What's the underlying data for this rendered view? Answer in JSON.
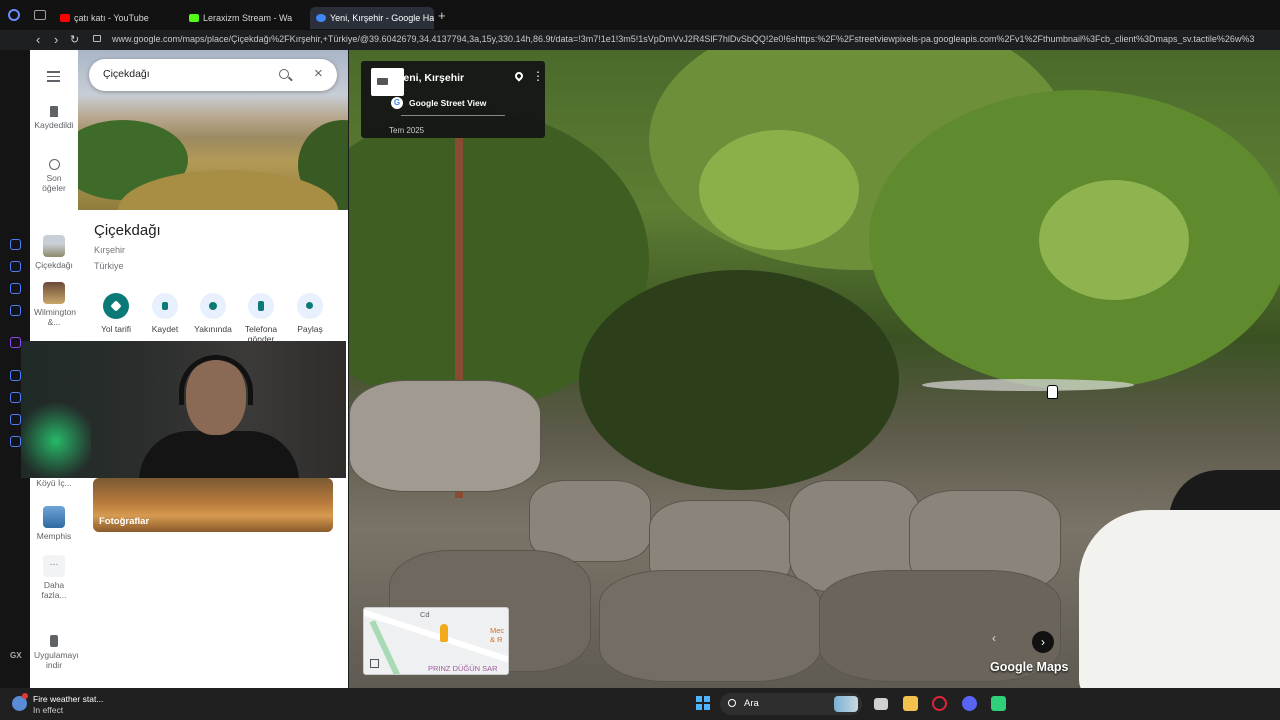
{
  "browser": {
    "tabs": [
      {
        "title": "çatı katı - YouTube",
        "favicon_color": "#ff0000",
        "active": false
      },
      {
        "title": "Leraxizm Stream - Wa",
        "favicon_color": "#53fc18",
        "active": false
      },
      {
        "title": "Yeni, Kırşehir - Google Ha",
        "favicon_color": "#4285f4",
        "active": true
      }
    ],
    "new_tab": "+",
    "back": "‹",
    "forward": "›",
    "reload": "↻",
    "url": "www.google.com/maps/place/Çiçekdağı%2FKırşehir,+Türkiye/@39.6042679,34.4137794,3a,15y,330.14h,86.9t/data=!3m7!1e1!3m5!1sVpDmVvJ2R4SlF7hlDvSbQQ!2e0!6shttps:%2F%2Fstreetviewpixels-pa.googleapis.com%2Fv1%2Fthumbnail%3Fcb_client%3Dmaps_sv.tactile%26w%3"
  },
  "rail": {
    "menu_icon": "hamburger-icon",
    "items": [
      {
        "label": "Kaydedildi",
        "icon": "bookmark-icon"
      },
      {
        "label": "Son öğeler",
        "icon": "history-icon"
      },
      {
        "label": "Çiçekdağı",
        "icon": "place-thumb"
      },
      {
        "label": "Wilmington &...",
        "icon": "place-thumb"
      },
      {
        "label": "Köyü İç...",
        "icon": "place-thumb"
      },
      {
        "label": "Memphis",
        "icon": "place-thumb"
      },
      {
        "label": "Daha fazla...",
        "icon": "more-icon"
      },
      {
        "label": "Uygulamayı indir",
        "icon": "phone-icon"
      }
    ]
  },
  "search": {
    "value": "Çiçekdağı"
  },
  "place": {
    "title": "Çiçekdağı",
    "region": "Kırşehir",
    "country": "Türkiye"
  },
  "actions": [
    {
      "label": "Yol tarifi",
      "icon": "directions-icon"
    },
    {
      "label": "Kaydet",
      "icon": "save-icon"
    },
    {
      "label": "Yakınında",
      "icon": "nearby-icon"
    },
    {
      "label": "Telefona gönder",
      "icon": "send-to-phone-icon"
    },
    {
      "label": "Paylaş",
      "icon": "share-icon"
    }
  ],
  "photos": {
    "label": "Fotoğraflar"
  },
  "collapse_icon": "‹",
  "streetview": {
    "location": "Yeni, Kırşehir",
    "brand": "Google Street View",
    "date": "Tem 2025",
    "google_g": "G",
    "more": "⋮",
    "minimap_labels": {
      "top": "Cd",
      "right": "Mec & R",
      "bottom": "PRINZ DÜĞÜN SAR"
    },
    "prev": "‹",
    "next": "›",
    "maps_brand": "Google Maps"
  },
  "taskbar": {
    "weather_title": "Fire weather stat...",
    "weather_status": "In effect",
    "search_placeholder": "Ara",
    "apps": [
      "file-explorer-icon",
      "folder-icon",
      "opera-icon",
      "discord-icon",
      "app-icon"
    ]
  },
  "colors": {
    "accent": "#0b7a77",
    "link": "#4285f4"
  }
}
